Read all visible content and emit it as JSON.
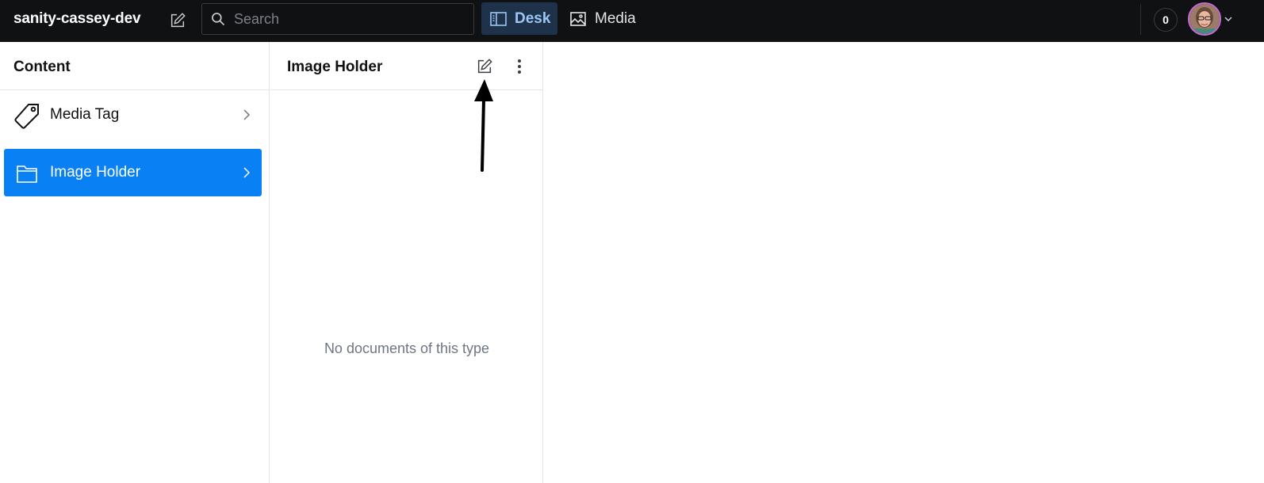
{
  "app": {
    "project_name": "sanity-cassey-dev",
    "new_document_icon": "compose-icon"
  },
  "search": {
    "placeholder": "Search",
    "value": "",
    "icon": "search-icon"
  },
  "nav": {
    "tabs": [
      {
        "label": "Desk",
        "icon": "desk-icon",
        "active": true
      },
      {
        "label": "Media",
        "icon": "image-icon",
        "active": false
      }
    ]
  },
  "user": {
    "presence_count": "0",
    "avatar": "user-avatar",
    "menu_icon": "chevron-down-icon"
  },
  "content_pane": {
    "title": "Content",
    "items": [
      {
        "label": "Media Tag",
        "icon": "tag-icon",
        "selected": false
      },
      {
        "label": "Image Holder",
        "icon": "folder-icon",
        "selected": true
      }
    ]
  },
  "document_pane": {
    "title": "Image Holder",
    "empty_message": "No documents of this type",
    "compose_icon": "compose-icon",
    "menu_icon": "ellipsis-vertical-icon"
  },
  "colors": {
    "topbar_bg": "#101112",
    "active_tab_bg": "#1e3349",
    "active_tab_text": "#9cc6f5",
    "selected_item_bg": "#0a80f5",
    "muted_text": "#6e7683",
    "border": "#e3e4e8"
  }
}
